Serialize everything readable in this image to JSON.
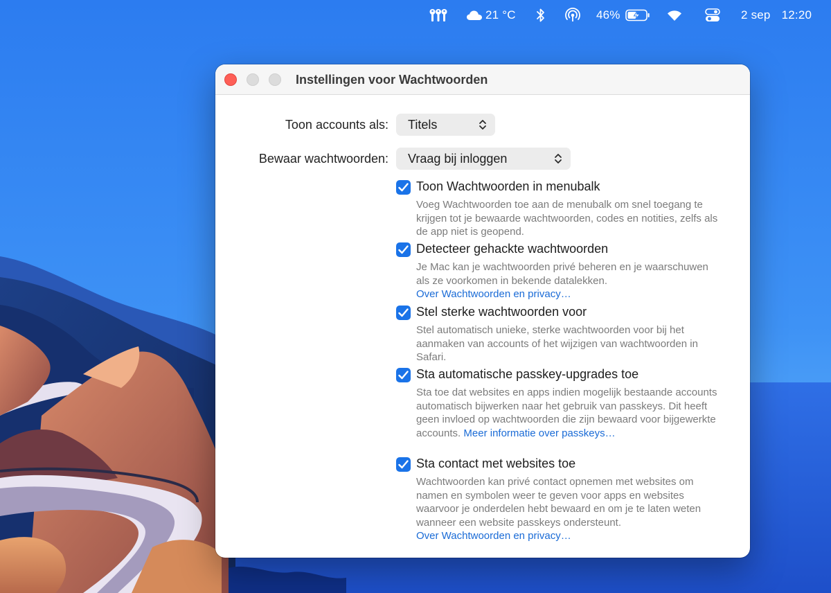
{
  "menubar": {
    "temperature": "21 °C",
    "battery_percent": "46%",
    "date": "2 sep",
    "time": "12:20",
    "icons": [
      "passwords-key-icon",
      "cloud-icon",
      "bluetooth-icon",
      "airdrop-icon",
      "battery-charging-icon",
      "wifi-icon",
      "control-center-icon"
    ]
  },
  "window": {
    "title": "Instellingen voor Wachtwoorden",
    "show_accounts": {
      "label": "Toon accounts als:",
      "value": "Titels"
    },
    "save_passwords": {
      "label": "Bewaar wachtwoorden:",
      "value": "Vraag bij inloggen"
    },
    "options": [
      {
        "checked": true,
        "title": "Toon Wachtwoorden in menubalk",
        "description": "Voeg Wachtwoorden toe aan de menubalk om snel toegang te krijgen tot je bewaarde wachtwoorden, codes en notities, zelfs als de app niet is geopend.",
        "link": ""
      },
      {
        "checked": true,
        "title": "Detecteer gehackte wachtwoorden",
        "description": "Je Mac kan je wachtwoorden privé beheren en je waarschuwen als ze voorkomen in bekende datalekken.",
        "link": "Over Wachtwoorden en privacy…"
      },
      {
        "checked": true,
        "title": "Stel sterke wachtwoorden voor",
        "description": "Stel automatisch unieke, sterke wachtwoorden voor bij het aanmaken van accounts of het wijzigen van wachtwoorden in Safari.",
        "link": ""
      },
      {
        "checked": true,
        "title": "Sta automatische passkey-upgrades toe",
        "description": "Sta toe dat websites en apps indien mogelijk bestaande accounts automatisch bijwerken naar het gebruik van passkeys. Dit heeft geen invloed op wachtwoorden die zijn bewaard voor bijgewerkte accounts.",
        "link": "Meer informatie over passkeys…"
      },
      {
        "checked": true,
        "title": "Sta contact met websites toe",
        "description": "Wachtwoorden kan privé contact opnemen met websites om namen en symbolen weer te geven voor apps en websites waarvoor je onderdelen hebt bewaard en om je te laten weten wanneer een website passkeys ondersteunt.",
        "link": "Over Wachtwoorden en privacy…"
      }
    ]
  }
}
